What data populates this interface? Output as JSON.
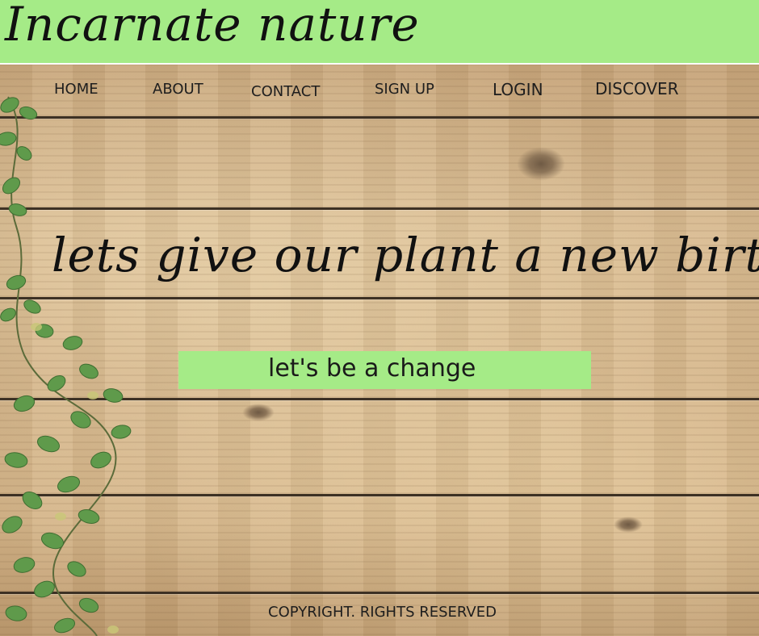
{
  "brand": {
    "title": "Incarnate nature"
  },
  "nav": {
    "home": "HOME",
    "about": "ABOUT",
    "contact": "CONTACT",
    "signup": "SIGN UP",
    "login": "LOGIN",
    "discover": "DISCOVER"
  },
  "hero": {
    "headline": "lets give our plant a new birth",
    "cta_label": "let's be a change"
  },
  "footer": {
    "copyright": "COPYRIGHT. RIGHTS RESERVED"
  },
  "colors": {
    "accent_green": "#a5eb87",
    "text_dark": "#111111",
    "wood": "#c9a878"
  },
  "icons": {
    "decoration": "ivy-vine-leaves"
  }
}
